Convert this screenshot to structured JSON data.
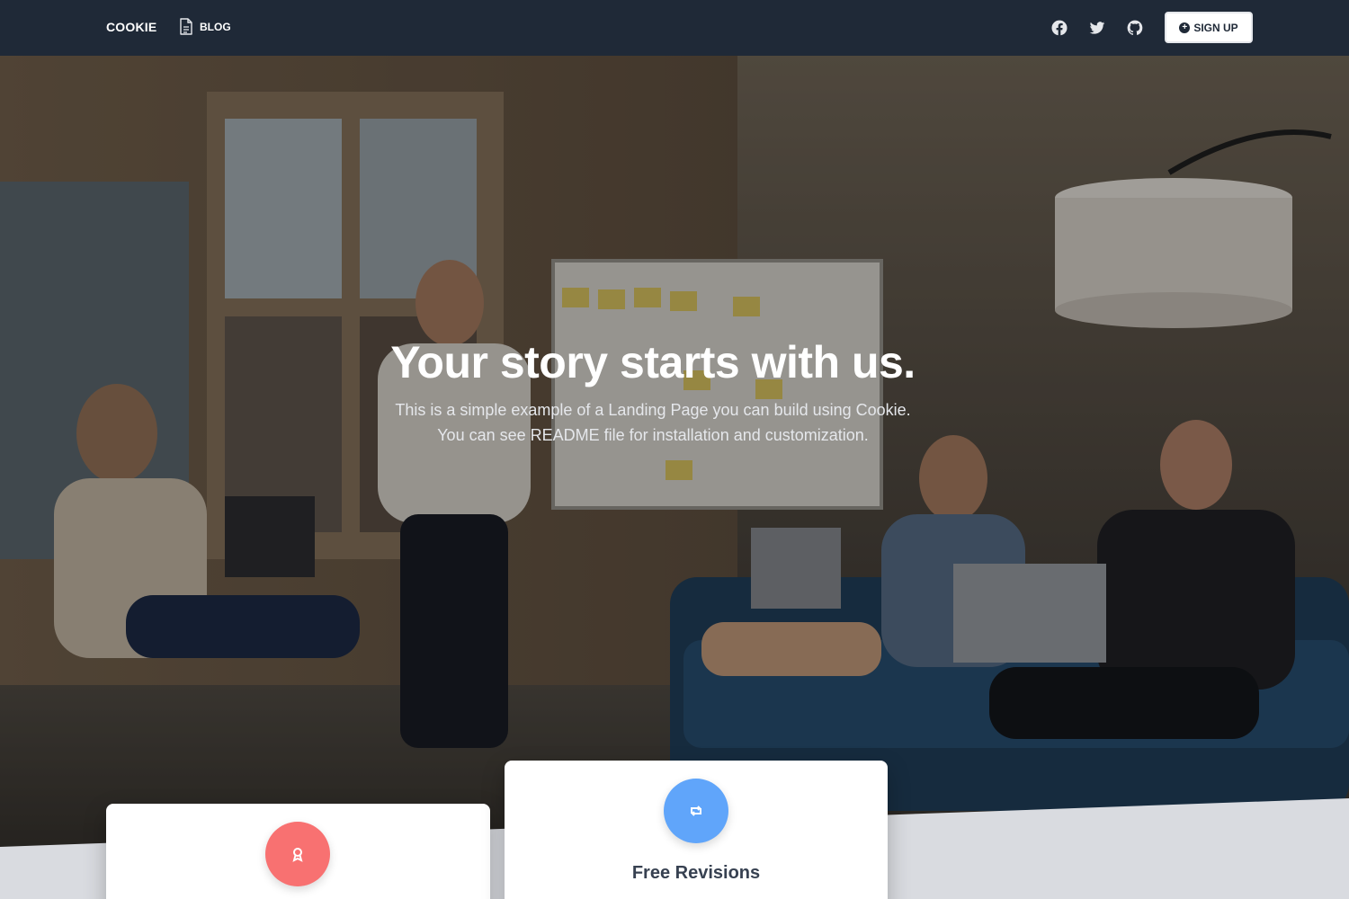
{
  "nav": {
    "brand": "COOKIE",
    "blog_label": "BLOG",
    "social": [
      {
        "name": "facebook-icon"
      },
      {
        "name": "twitter-icon"
      },
      {
        "name": "github-icon"
      }
    ],
    "signup_label": "SIGN UP"
  },
  "hero": {
    "title": "Your story starts with us.",
    "subtitle": "This is a simple example of a Landing Page you can build using Cookie. You can see README file for installation and customization."
  },
  "features": [
    {
      "title": "",
      "icon": "award-icon",
      "color": "#f87171"
    },
    {
      "title": "Free Revisions",
      "icon": "retweet-icon",
      "color": "#60a5fa"
    }
  ],
  "colors": {
    "navbar": "#1f2937",
    "page_bg": "#d9dbe0",
    "accent_red": "#f87171",
    "accent_blue": "#60a5fa"
  }
}
